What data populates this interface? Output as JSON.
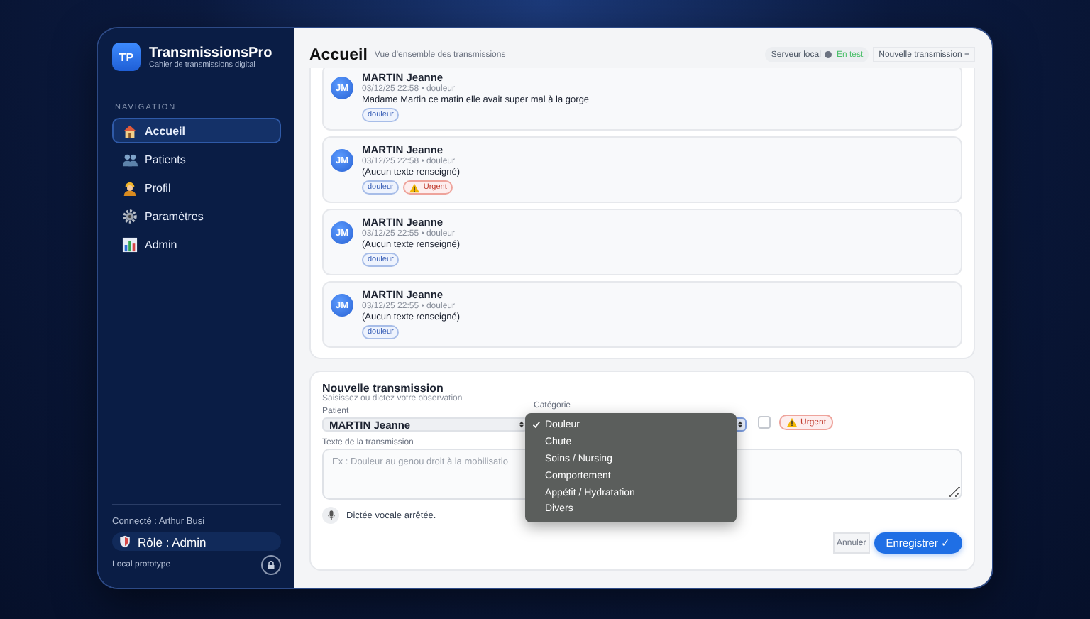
{
  "app": {
    "logo": "TP",
    "name": "TransmissionsPro",
    "tagline": "Cahier de transmissions digital"
  },
  "sidebar": {
    "section": "NAVIGATION",
    "items": [
      {
        "label": "Accueil",
        "selected": true
      },
      {
        "label": "Patients",
        "selected": false
      },
      {
        "label": "Profil",
        "selected": false
      },
      {
        "label": "Paramètres",
        "selected": false
      },
      {
        "label": "Admin",
        "selected": false
      }
    ],
    "user": "Connecté : Arthur Busi",
    "role": "Rôle : Admin",
    "mode": "Local prototype"
  },
  "header": {
    "title": "Accueil",
    "subtitle": "Vue d'ensemble des transmissions",
    "server_label": "Serveur local",
    "server_status": "En test",
    "new_button": "Nouvelle transmission +"
  },
  "transmissions": [
    {
      "initials": "JM",
      "patient": "MARTIN Jeanne",
      "meta": "03/12/25 22:58 • douleur",
      "text": "Madame Martin ce matin elle avait super mal à la gorge",
      "tags": [
        {
          "label": "douleur",
          "kind": "category"
        }
      ]
    },
    {
      "initials": "JM",
      "patient": "MARTIN Jeanne",
      "meta": "03/12/25 22:58 • douleur",
      "text": "(Aucun texte renseigné)",
      "tags": [
        {
          "label": "douleur",
          "kind": "category"
        },
        {
          "label": "Urgent",
          "kind": "urgent"
        }
      ]
    },
    {
      "initials": "JM",
      "patient": "MARTIN Jeanne",
      "meta": "03/12/25 22:55 • douleur",
      "text": "(Aucun texte renseigné)",
      "tags": [
        {
          "label": "douleur",
          "kind": "category"
        }
      ]
    },
    {
      "initials": "JM",
      "patient": "MARTIN Jeanne",
      "meta": "03/12/25 22:55 • douleur",
      "text": "(Aucun texte renseigné)",
      "tags": [
        {
          "label": "douleur",
          "kind": "category"
        }
      ]
    }
  ],
  "form": {
    "title": "Nouvelle transmission",
    "subtitle": "Saisissez ou dictez votre observation",
    "patient_label": "Patient",
    "patient_value": "MARTIN Jeanne",
    "category_label": "Catégorie",
    "category_menu": [
      {
        "label": "Douleur",
        "selected": true
      },
      {
        "label": "Chute",
        "selected": false
      },
      {
        "label": "Soins / Nursing",
        "selected": false
      },
      {
        "label": "Comportement",
        "selected": false
      },
      {
        "label": "Appétit / Hydratation",
        "selected": false
      },
      {
        "label": "Divers",
        "selected": false
      }
    ],
    "urgent": {
      "checked": false,
      "label": "Urgent"
    },
    "text_label": "Texte de la transmission",
    "text_placeholder": "Ex : Douleur au genou droit à la mobilisatio",
    "voice_status": "Dictée vocale arrêtée.",
    "cancel": "Annuler",
    "save": "Enregistrer ✓"
  }
}
